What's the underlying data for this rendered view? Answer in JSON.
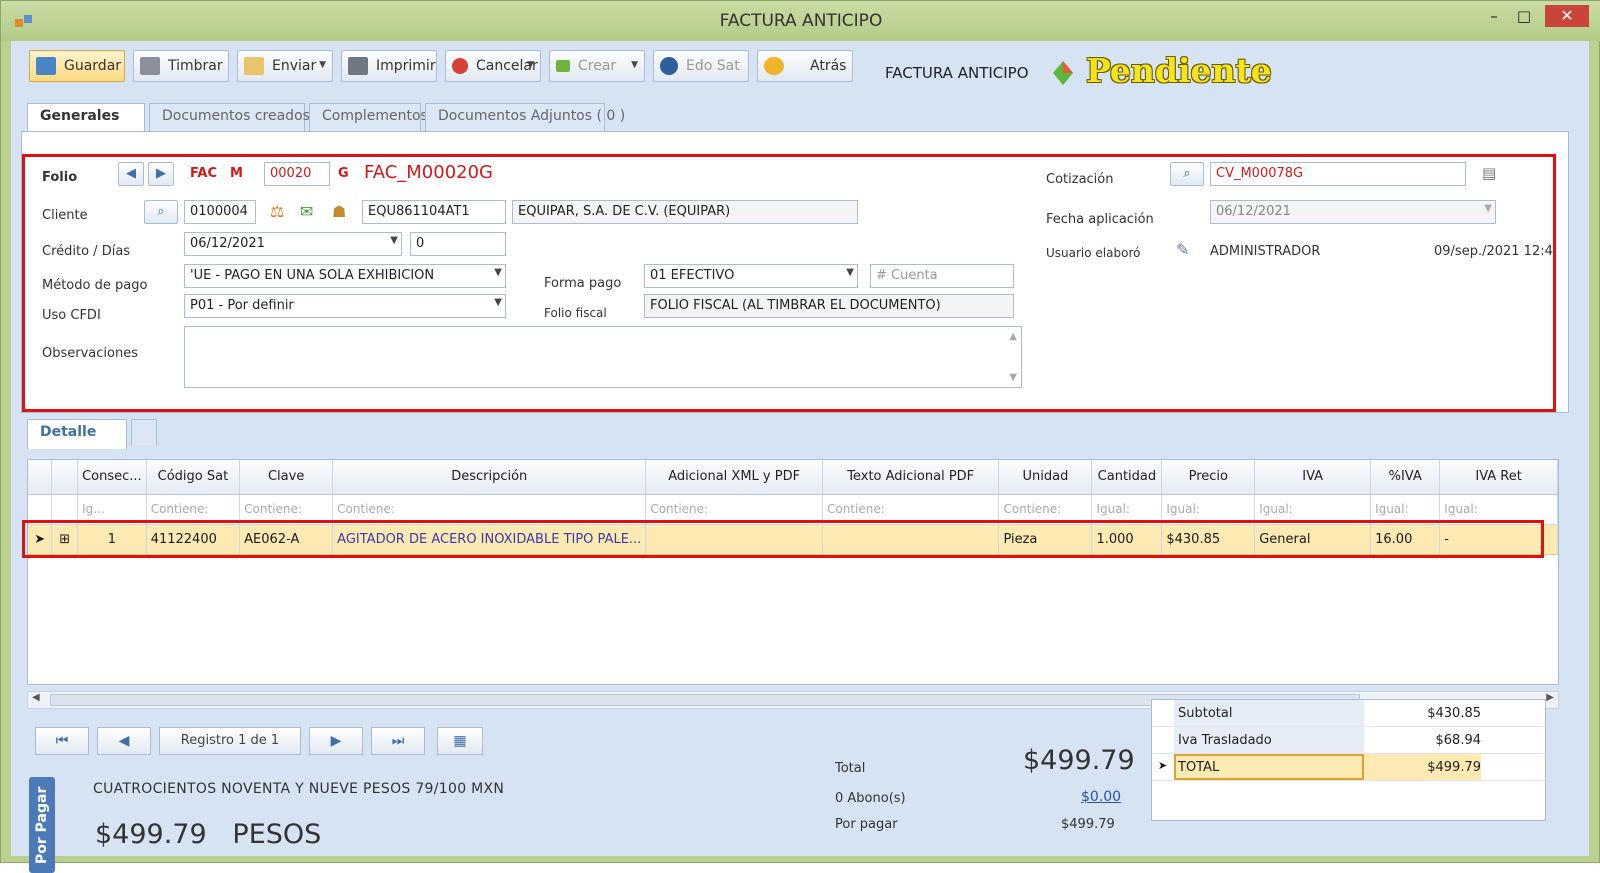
{
  "window": {
    "title": "FACTURA ANTICIPO",
    "min": "–",
    "max": "□",
    "close": "✕"
  },
  "toolbar": {
    "guardar": "Guardar",
    "timbrar": "Timbrar",
    "enviar": "Enviar",
    "imprimir": "Imprimir",
    "cancelar": "Cancelar",
    "crear": "Crear",
    "edo_sat": "Edo Sat",
    "atras": "Atrás",
    "doc_title": "FACTURA ANTICIPO",
    "status": "Pendiente"
  },
  "tabs": [
    "Generales",
    "Documentos creados",
    "Complementos",
    "Documentos Adjuntos ( 0 )"
  ],
  "form": {
    "folio_label": "Folio",
    "serie": "FAC",
    "letra": "M",
    "numero": "00020",
    "sufijo": "G",
    "folio_full": "FAC_M00020G",
    "cliente_label": "Cliente",
    "cliente_codigo": "0100004",
    "cliente_rfc": "EQU861104AT1",
    "cliente_nombre": "EQUIPAR, S.A. DE C.V. (EQUIPAR)",
    "credito_label": "Crédito / Días",
    "credito_fecha": "06/12/2021",
    "credito_dias": "0",
    "metodo_label": "Método de pago",
    "metodo_value": "'UE - PAGO EN UNA SOLA EXHIBICION",
    "uso_label": "Uso CFDI",
    "uso_value": "P01 - Por definir",
    "obs_label": "Observaciones",
    "forma_label": "Forma pago",
    "forma_value": "01 EFECTIVO",
    "cuenta_placeholder": "# Cuenta",
    "folio_fiscal_label": "Folio fiscal",
    "folio_fiscal_value": "FOLIO FISCAL (AL TIMBRAR EL DOCUMENTO)",
    "cotizacion_label": "Cotización",
    "cotizacion_value": "CV_M00078G",
    "fecha_aplic_label": "Fecha aplicación",
    "fecha_aplic_value": "06/12/2021",
    "usuario_label": "Usuario elaboró",
    "usuario_value": "ADMINISTRADOR",
    "usuario_fecha": "09/sep./2021 12:4"
  },
  "detalle_tab": "Detalle",
  "grid": {
    "headers": [
      "Consec...",
      "Código Sat",
      "Clave",
      "Descripción",
      "Adicional XML y PDF",
      "Texto Adicional PDF",
      "Unidad",
      "Cantidad",
      "Precio",
      "IVA",
      "%IVA",
      "IVA Ret"
    ],
    "filters": [
      "Ig...",
      "Contiene:",
      "Contiene:",
      "Contiene:",
      "Contiene:",
      "Contiene:",
      "Contiene:",
      "Igual:",
      "Igual:",
      "Igual:",
      "Igual:",
      "Igual:"
    ],
    "rows": [
      [
        "1",
        "41122400",
        "AE062-A",
        "AGITADOR DE ACERO INOXIDABLE TIPO PALE...",
        "",
        "",
        "Pieza",
        "1.000",
        "$430.85",
        "General",
        "16.00",
        "-"
      ]
    ]
  },
  "pager": {
    "record": "Registro  1  de  1"
  },
  "footer": {
    "porpagar_tag": "Por Pagar",
    "words": "CUATROCIENTOS NOVENTA Y NUEVE PESOS 79/100 MXN",
    "big_amount": "$499.79",
    "currency": "PESOS",
    "total_label": "Total",
    "total_value": "$499.79",
    "abonos_label": "0 Abono(s)",
    "abonos_value": "$0.00",
    "porpagar_label": "Por pagar",
    "porpagar_value": "$499.79"
  },
  "totals": [
    {
      "label": "Subtotal",
      "value": "$430.85"
    },
    {
      "label": "Iva Trasladado",
      "value": "$68.94"
    },
    {
      "label": "TOTAL",
      "value": "$499.79"
    }
  ],
  "colors": {
    "accent": "#3e6fa8",
    "highlight_red": "#e01010",
    "status_yellow": "#f5e418",
    "row_selected": "#fde9b2"
  }
}
